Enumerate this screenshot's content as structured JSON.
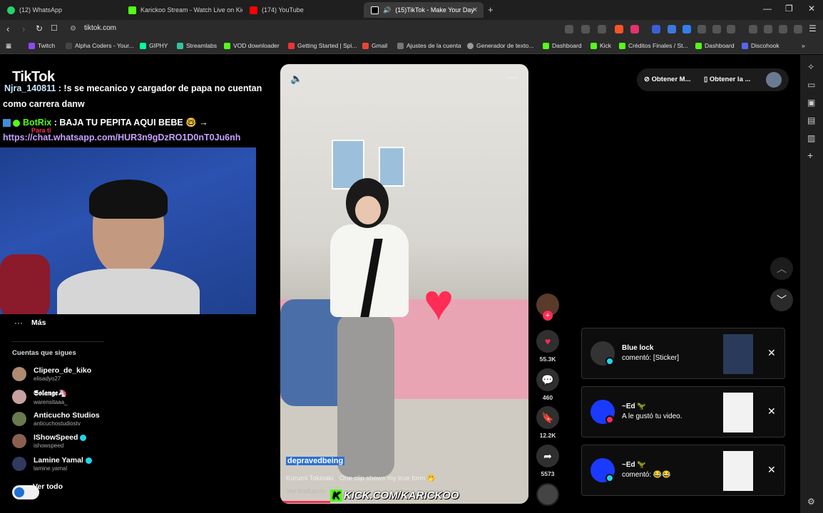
{
  "tabs": [
    {
      "label": "(12) WhatsApp",
      "color": "#25d366"
    },
    {
      "label": "Karickoo Stream - Watch Live on Kick",
      "color": "#53fc18"
    },
    {
      "label": "(174) YouTube",
      "color": "#ff0000"
    },
    {
      "label": "(15)TikTok - Make Your Day",
      "color": "#ffffff"
    }
  ],
  "new_tab": "+",
  "window": {
    "minimize": "—",
    "maximize": "❐",
    "close": "✕"
  },
  "address": {
    "url": "tiktok.com"
  },
  "bookmarks": [
    {
      "label": "Twitch",
      "color": "#9146ff"
    },
    {
      "label": "Alpha Coders - Your...",
      "color": "#444"
    },
    {
      "label": "GIPHY",
      "color": "#00ff99"
    },
    {
      "label": "Streamlabs",
      "color": "#31c3a2"
    },
    {
      "label": "VOD downloader",
      "color": "#53fc18"
    },
    {
      "label": "Getting Started | Spi...",
      "color": "#e33"
    },
    {
      "label": "Gmail",
      "color": "#ea4335"
    },
    {
      "label": "Ajustes de la cuenta",
      "color": "#777"
    },
    {
      "label": "Generador de texto...",
      "color": "#999"
    },
    {
      "label": "Dashboard",
      "color": "#53fc18"
    },
    {
      "label": "Kick",
      "color": "#53fc18"
    },
    {
      "label": "Créditos Finales / St...",
      "color": "#53fc18"
    },
    {
      "label": "Dashboard",
      "color": "#53fc18"
    },
    {
      "label": "Discohook",
      "color": "#5865f2"
    }
  ],
  "tiktok": {
    "logo": "TikTok"
  },
  "chat": {
    "line1_user": "Njra_140811",
    "line1_text": " : !s se mecanico y cargador de papa no cuentan",
    "line1_text2": "como carrera danw",
    "line2_user": "BotRix",
    "line2_text": " : BAJA TU PEPITA AQUI BEBE 🤓 →",
    "line2_link": "https://chat.whatsapp.com/HUR3n9gDzRO1D0nT0Ju6nh",
    "para_ti": "Para ti"
  },
  "sidebar": {
    "more_label": "Más",
    "following_title": "Cuentas que sigues",
    "accounts": [
      {
        "name": "Clipero_de_kiko",
        "handle": "elisadyo27",
        "verified": false,
        "color": "#b08a70"
      },
      {
        "name": "𝕾𝖔𝖑𝖆𝖓𝖌𝖊🦄",
        "handle": "warensitaaa_",
        "verified": false,
        "color": "#c8a0a0"
      },
      {
        "name": "Anticucho Studios",
        "handle": "anticuchostudiostv",
        "verified": false,
        "color": "#6a7a50"
      },
      {
        "name": "IShowSpeed",
        "handle": "ishowspeed",
        "verified": true,
        "color": "#8a6050"
      },
      {
        "name": "Lamine Yamal",
        "handle": "lamine.yamal",
        "verified": true,
        "color": "#303a60"
      }
    ],
    "see_all": "Ver todo"
  },
  "video": {
    "author": "depravedbeing",
    "music_artist": "Kurumi Tokisaki",
    "caption": "One clip shows my true form 🤭",
    "translate": "Ver traducció",
    "watermark": "KICK.COM/KARICKOO"
  },
  "actions": {
    "likes": "55.3K",
    "comments": "460",
    "saves": "12.2K",
    "shares": "5573"
  },
  "header_buttons": {
    "get_coins": "Obtener M...",
    "get_app": "Obtener la ..."
  },
  "notifications": [
    {
      "title": "Blue lock",
      "text": "comentó: [Sticker]",
      "color": "#333"
    },
    {
      "title": "~Ed 🦖",
      "text": "A le gustó tu video.",
      "color": "#1a3aff"
    },
    {
      "title": "~Ed 🦖",
      "text": "comentó: 😂😂",
      "color": "#1a3aff"
    }
  ]
}
